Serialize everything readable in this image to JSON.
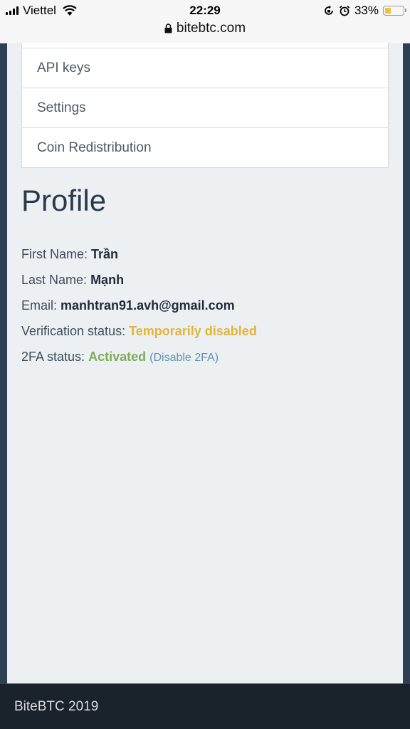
{
  "status_bar": {
    "carrier": "Viettel",
    "time": "22:29",
    "battery": "33%",
    "battery_level": 0.33,
    "url": "bitebtc.com"
  },
  "menu": {
    "items": [
      {
        "label": "API keys"
      },
      {
        "label": "Settings"
      },
      {
        "label": "Coin Redistribution"
      }
    ]
  },
  "profile": {
    "title": "Profile",
    "first_name_label": "First Name:",
    "first_name": "Trần",
    "last_name_label": "Last Name:",
    "last_name": "Mạnh",
    "email_label": "Email:",
    "email": "manhtran91.avh@gmail.com",
    "verification_label": "Verification status:",
    "verification_value": "Temporarily disabled",
    "twofa_label": "2FA status:",
    "twofa_value": "Activated",
    "twofa_link": "(Disable 2FA)"
  },
  "colors": {
    "warning": "#e0b53a",
    "success": "#7eab5a",
    "link": "#5d94b0",
    "footer_bg": "#1a222c"
  },
  "footer": {
    "text": "BiteBTC 2019"
  }
}
